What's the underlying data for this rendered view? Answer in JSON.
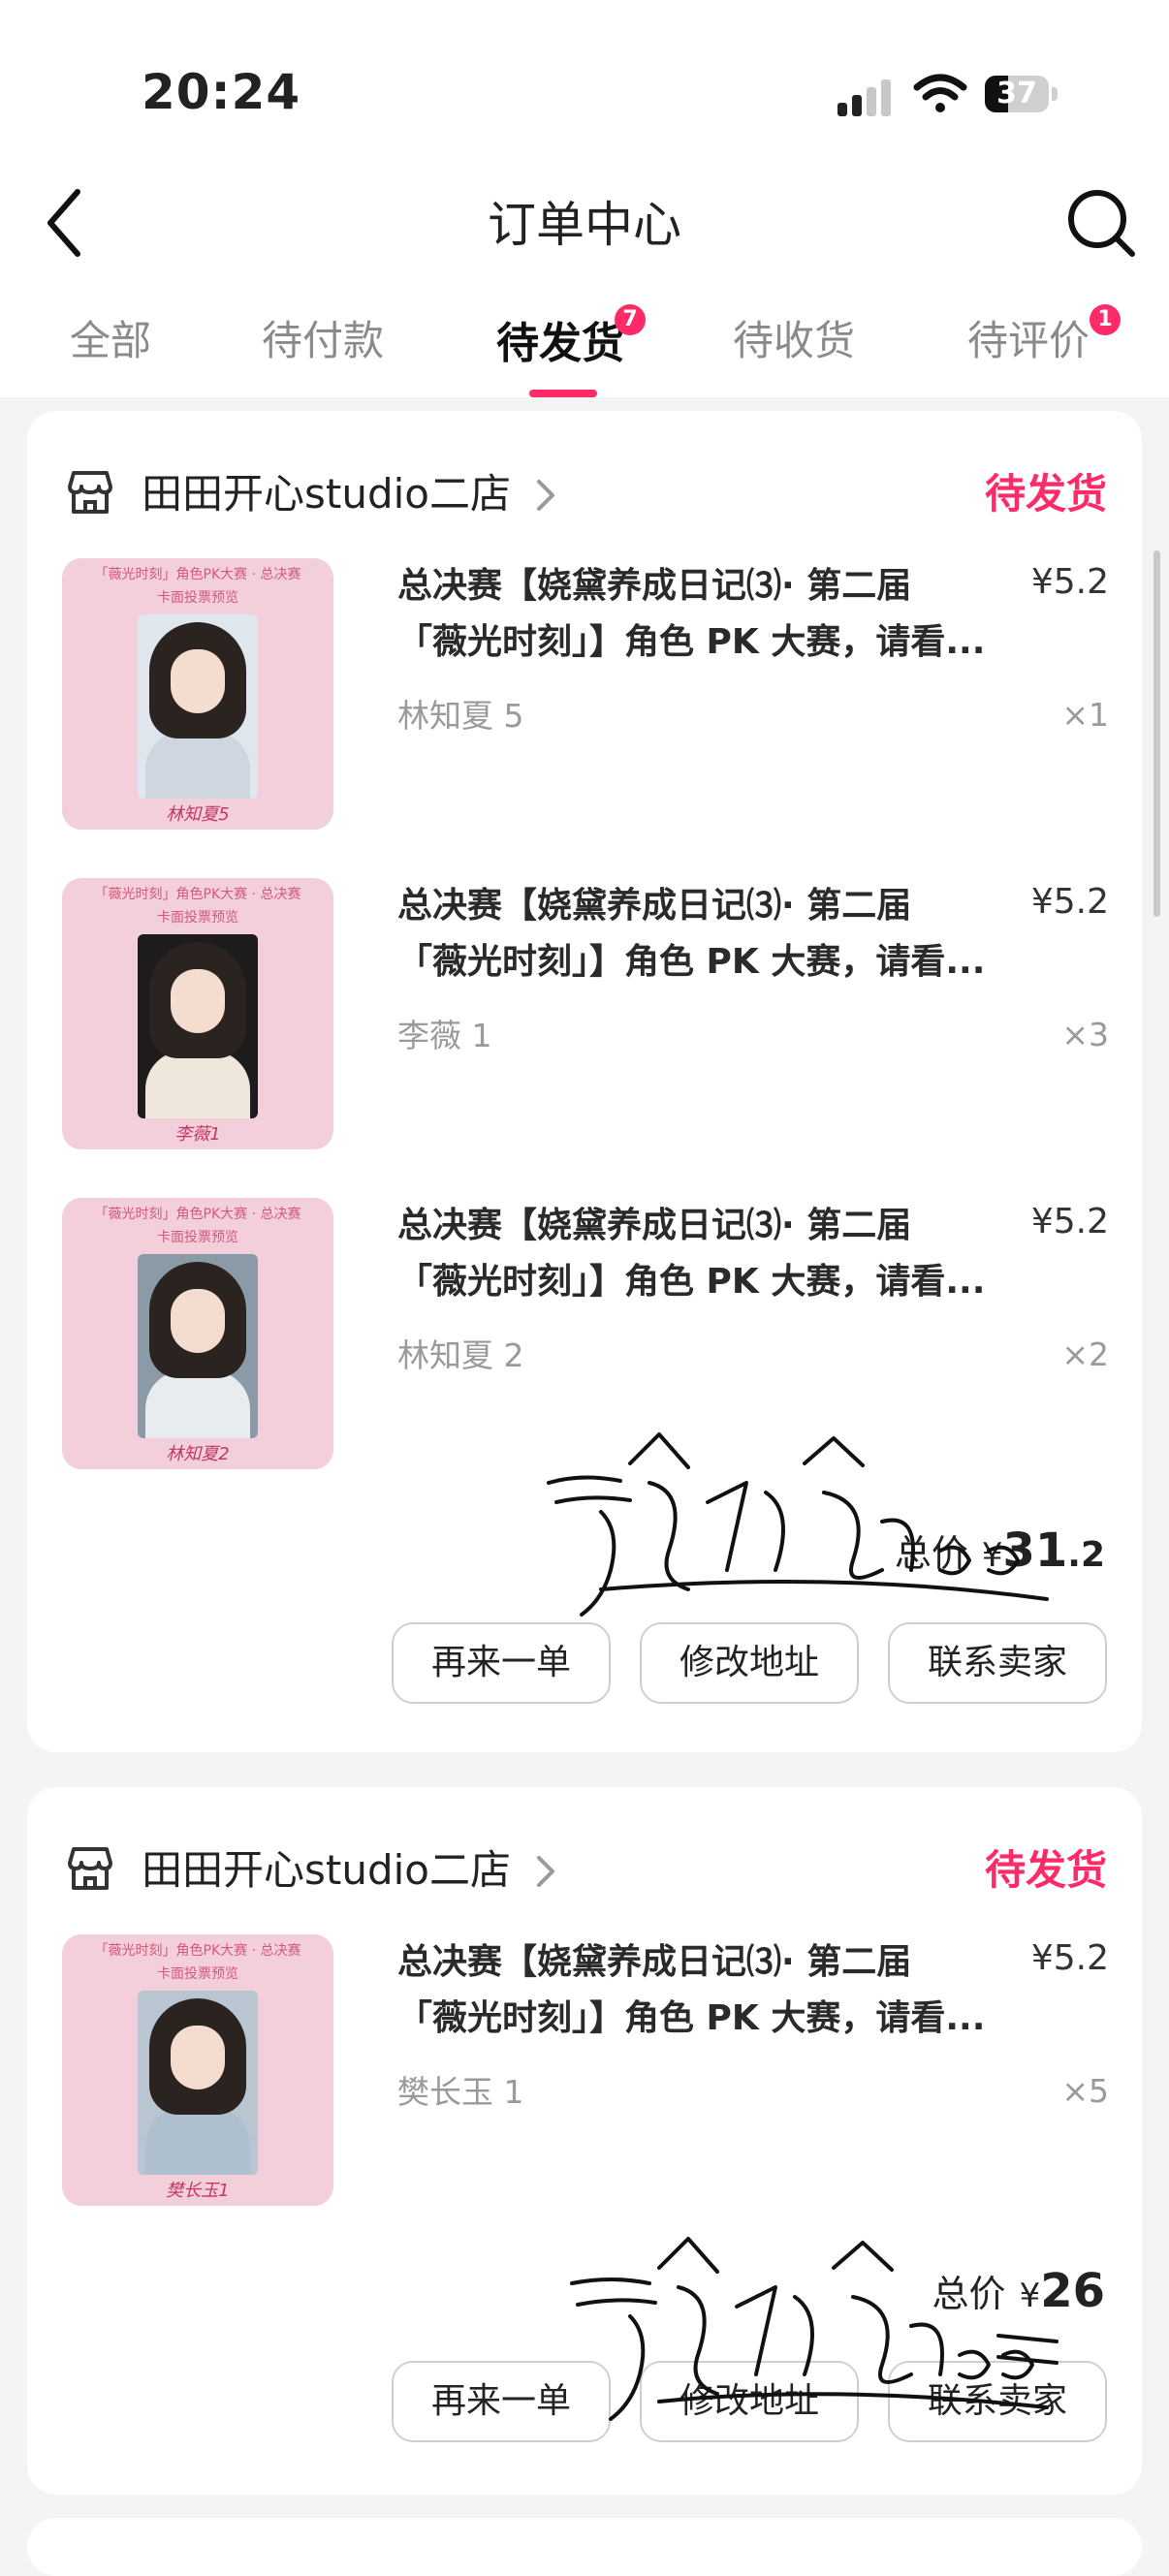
{
  "status_bar": {
    "time": "20:24",
    "battery": "37",
    "battery_level": 0.37
  },
  "header": {
    "title": "订单中心"
  },
  "tabs": [
    {
      "label": "全部"
    },
    {
      "label": "待付款"
    },
    {
      "label": "待发货",
      "badge": "7",
      "active": true
    },
    {
      "label": "待收货"
    },
    {
      "label": "待评价",
      "badge": "1"
    }
  ],
  "orders": [
    {
      "shop": "田田开心studio二店",
      "status": "待发货",
      "items": [
        {
          "title_line1": "总决赛【娆黛养成日记⑶· 第二届",
          "title_line2": "「薇光时刻」】角色 PK 大赛，请看...",
          "variant": "林知夏 5",
          "price": "¥5.2",
          "qty": "×1",
          "thumb_caption": "林知夏5"
        },
        {
          "title_line1": "总决赛【娆黛养成日记⑶· 第二届",
          "title_line2": "「薇光时刻」】角色 PK 大赛，请看...",
          "variant": "李薇 1",
          "price": "¥5.2",
          "qty": "×3",
          "thumb_caption": "李薇1"
        },
        {
          "title_line1": "总决赛【娆黛养成日记⑶· 第二届",
          "title_line2": "「薇光时刻」】角色 PK 大赛，请看...",
          "variant": "林知夏 2",
          "price": "¥5.2",
          "qty": "×2",
          "thumb_caption": "林知夏2"
        }
      ],
      "total_label": "总价",
      "total_currency": "¥",
      "total_int": "31",
      "total_dec": ".2",
      "buttons": [
        "再来一单",
        "修改地址",
        "联系卖家"
      ]
    },
    {
      "shop": "田田开心studio二店",
      "status": "待发货",
      "items": [
        {
          "title_line1": "总决赛【娆黛养成日记⑶· 第二届",
          "title_line2": "「薇光时刻」】角色 PK 大赛，请看...",
          "variant": "樊长玉 1",
          "price": "¥5.2",
          "qty": "×5",
          "thumb_caption": "樊长玉1"
        }
      ],
      "total_label": "总价",
      "total_currency": "¥",
      "total_int": "26",
      "total_dec": "",
      "buttons": [
        "再来一单",
        "修改地址",
        "联系卖家"
      ]
    }
  ],
  "thumb_header_line1": "「薇光时刻」角色PK大赛 · 总决赛",
  "thumb_header_line2": "卡面投票预览",
  "colors": {
    "accent": "#ff2a68",
    "thumb_bg": "#f3cfdb"
  },
  "icons": [
    "back-icon",
    "search-icon",
    "shop-icon",
    "chevron-right-icon",
    "wifi-icon",
    "cell-signal-icon",
    "battery-icon"
  ]
}
